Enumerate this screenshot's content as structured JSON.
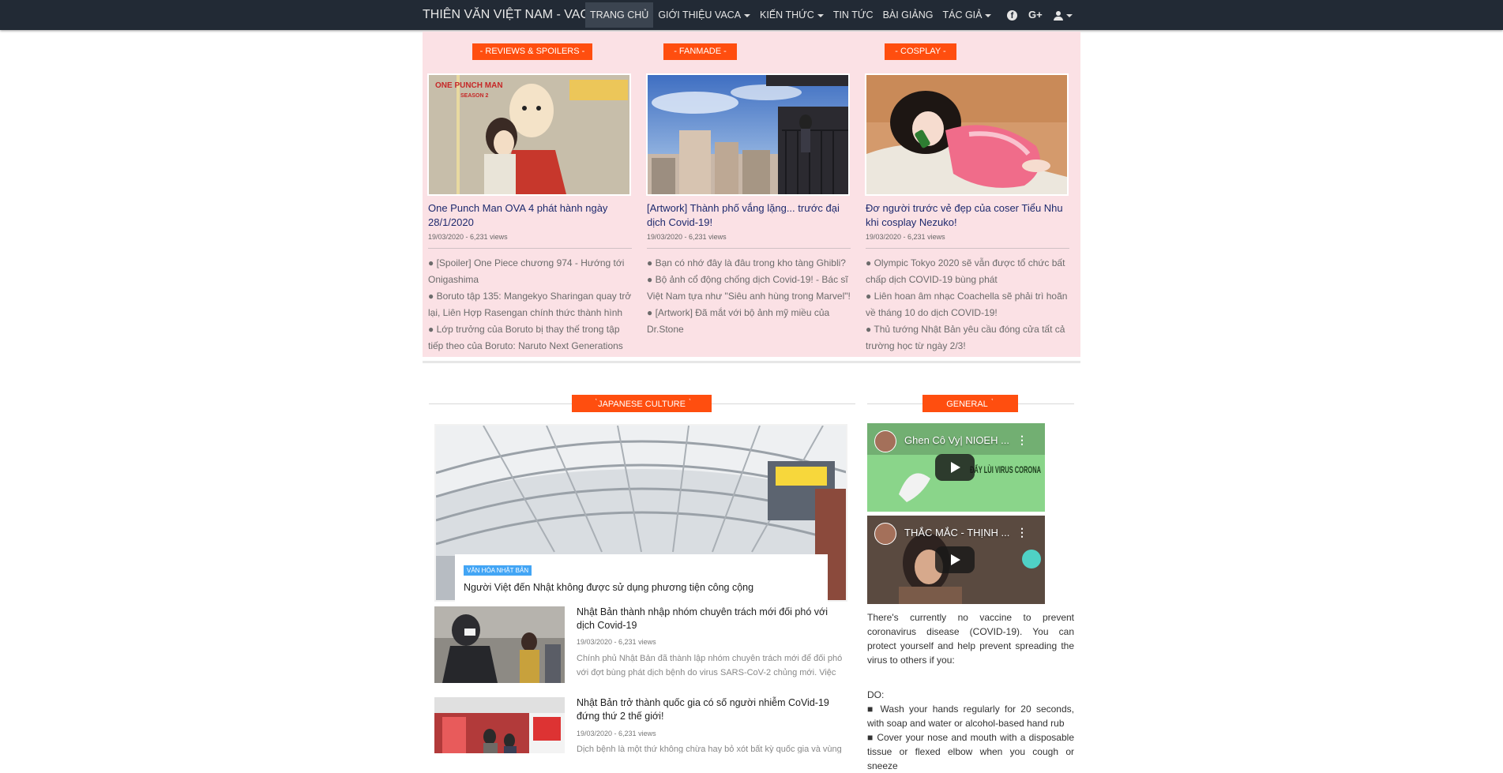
{
  "nav": {
    "brand": "THIÊN VĂN VIỆT NAM - VACA",
    "items": [
      {
        "label": "TRANG CHỦ",
        "dropdown": false
      },
      {
        "label": "GIỚI THIỆU VACA",
        "dropdown": true
      },
      {
        "label": "KIẾN THỨC",
        "dropdown": true
      },
      {
        "label": "TIN TỨC",
        "dropdown": false
      },
      {
        "label": "BÀI GIẢNG",
        "dropdown": false
      },
      {
        "label": "TÁC GIẢ",
        "dropdown": true
      }
    ],
    "icons": [
      "facebook-icon",
      "google-plus-icon",
      "user-icon"
    ],
    "google_plus_label": "G+"
  },
  "columns": [
    {
      "category": "- REVIEWS & SPOILERS -",
      "title": "One Punch Man OVA 4 phát hành ngày 28/1/2020",
      "meta": "19/03/2020 - 6,231 views",
      "thumb_text_1": "ONE PUNCH MAN",
      "thumb_text_2": "SEASON 2",
      "links": [
        "● [Spoiler] One Piece chương 974 - Hướng tới Onigashima",
        "● Boruto tập 135: Mangekyo Sharingan quay trở lại, Liên Hợp Rasengan chính thức thành hình",
        "● Lớp trưởng của Boruto bị thay thế trong tập tiếp theo của Boruto: Naruto Next Generations"
      ]
    },
    {
      "category": "- FANMADE -",
      "title": "[Artwork] Thành phố vắng lặng... trước đại dịch Covid-19!",
      "meta": "19/03/2020 - 6,231 views",
      "links": [
        "● Bạn có nhớ đây là đâu trong kho tàng Ghibli?",
        "● Bộ ảnh cổ động chống dịch Covid-19! - Bác sĩ Việt Nam tựa như \"Siêu anh hùng trong Marvel\"!",
        "● [Artwork] Đã mắt với bộ ảnh mỹ miều của Dr.Stone"
      ]
    },
    {
      "category": "- COSPLAY -",
      "title": "Đơ người trước vẻ đẹp của coser Tiểu Nhu khi cosplay Nezuko!",
      "meta": "19/03/2020 - 6,231 views",
      "links": [
        "● Olympic Tokyo 2020 sẽ vẫn được tổ chức bất chấp dịch COVID-19 bùng phát",
        "● Liên hoan âm nhạc Coachella sẽ phải trì hoãn về tháng 10 do dịch COVID-19!",
        "● Thủ tướng Nhật Bản yêu cầu đóng cửa tất cả trường học từ ngày 2/3!"
      ]
    }
  ],
  "japanese_culture": {
    "section_title": "JAPANESE CULTURE",
    "feature": {
      "tag": "VĂN HÓA NHẬT BẢN",
      "title": "Người Việt đến Nhật không được sử dụng phương tiện công cộng"
    },
    "articles": [
      {
        "title": "Nhật Bản thành nhập nhóm chuyên trách mới đối phó với dịch Covid-19",
        "meta": "19/03/2020 - 6,231 views",
        "excerpt": "Chính phủ Nhật Bản đã thành lập nhóm chuyên trách mới để đối phó với đợt bùng phát dịch bệnh do virus SARS-CoV-2 chủng mới. Việc này"
      },
      {
        "title": "Nhật Bản trở thành quốc gia có số người nhiễm CoVid-19 đứng thứ 2 thế giới!",
        "meta": "19/03/2020 - 6,231 views",
        "excerpt": "Dịch bệnh là một thứ không chừa hay bỏ xót bất kỳ quốc gia và vùng"
      }
    ]
  },
  "general": {
    "section_title": "GENERAL",
    "videos": [
      {
        "title": "Ghen Cô Vy| NIOEH ...",
        "overlay": "ĐẨY LÙI VIRUS CORONA"
      },
      {
        "title": "THẮC MẮC - THỊNH ..."
      }
    ],
    "intro": "There's currently no vaccine to prevent coronavirus disease (COVID-19). You can protect yourself and help prevent spreading the virus to others if you:",
    "do_label": "DO:",
    "do_items": [
      "■ Wash your hands regularly for 20 seconds, with soap and water or alcohol-based hand rub",
      "■ Cover your nose and mouth with a disposable tissue or flexed elbow when you cough or sneeze"
    ]
  }
}
